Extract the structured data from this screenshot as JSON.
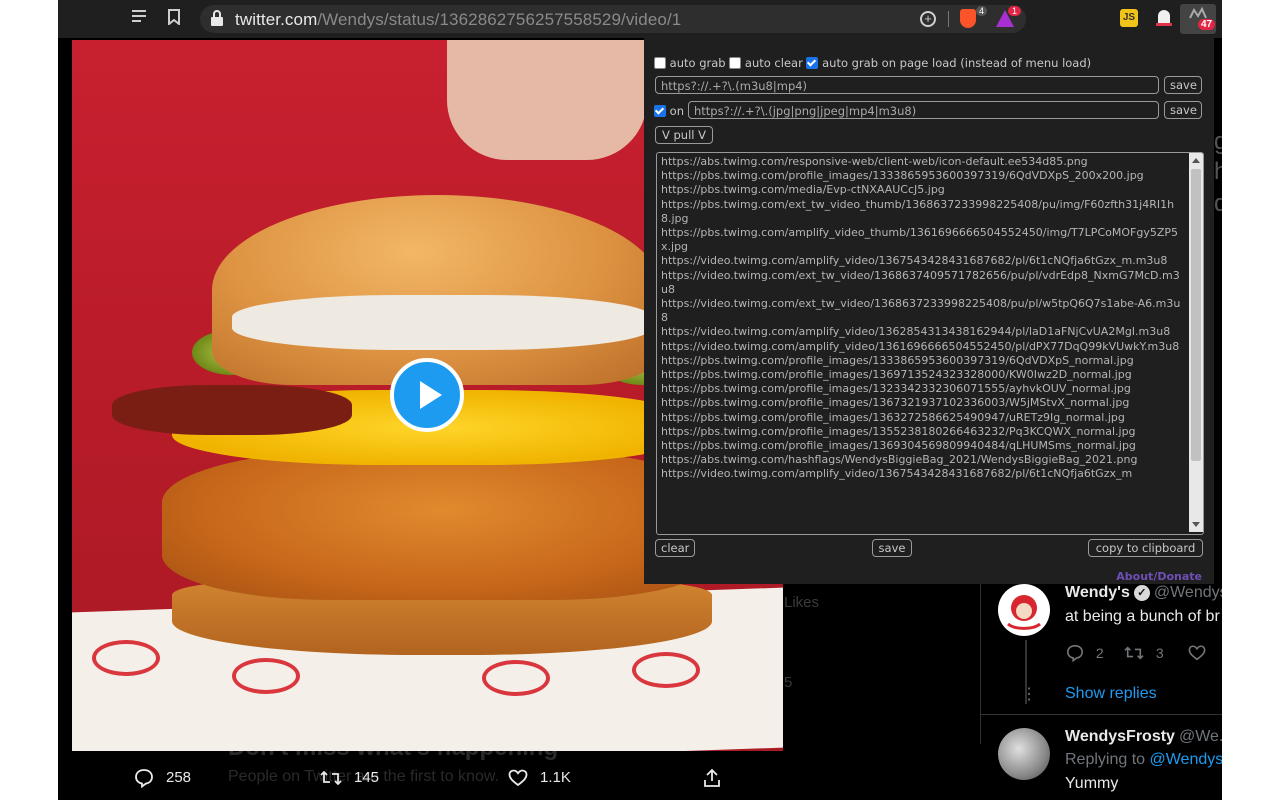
{
  "browser": {
    "url_host": "twitter.com",
    "url_path": "/Wendys/status/1362862756257558529/video/1",
    "brave_shield_count": "4",
    "rewards_badge": "1",
    "grabber_badge": "47"
  },
  "tweet_actions": {
    "replies": "258",
    "retweets": "145",
    "likes": "1.1K"
  },
  "background_text": {
    "dont_miss": "Don't miss what's happening",
    "people_on": "People on Twitter are the first to know.",
    "likes_label": "Likes",
    "number_fragment": "5"
  },
  "replies": [
    {
      "name": "Wendy's",
      "handle": "@Wendys",
      "text": "at being a bunch of br",
      "reply_count": "2",
      "retweet_count": "3",
      "show_replies": "Show replies"
    },
    {
      "name": "WendysFrosty",
      "handle": "@We...",
      "replying_label": "Replying to",
      "replying_handle": "@Wendys",
      "text": "Yummy"
    }
  ],
  "grabber_panel": {
    "auto_grab_label": "auto grab",
    "auto_clear_label": "auto clear",
    "auto_grab_page_load_label": "auto grab on page load (instead of menu load)",
    "auto_grab_checked": false,
    "auto_clear_checked": false,
    "auto_grab_page_load_checked": true,
    "pattern1": "https?://.+?\\.(m3u8|mp4)",
    "save_label": "save",
    "on_label": "on",
    "on_checked": true,
    "pattern2": "https?://.+?\\.(jpg|png|jpeg|mp4|m3u8)",
    "pull_label": "V pull V",
    "urls": [
      "https://abs.twimg.com/responsive-web/client-web/icon-default.ee534d85.png",
      "https://pbs.twimg.com/profile_images/1333865953600397319/6QdVDXpS_200x200.jpg",
      "https://pbs.twimg.com/media/Evp-ctNXAAUCcJ5.jpg",
      "https://pbs.twimg.com/ext_tw_video_thumb/1368637233998225408/pu/img/F60zfth31j4RI1h8.jpg",
      "https://pbs.twimg.com/amplify_video_thumb/1361696666504552450/img/T7LPCoMOFgy5ZP5x.jpg",
      "https://video.twimg.com/amplify_video/1367543428431687682/pl/6t1cNQfja6tGzx_m.m3u8",
      "https://video.twimg.com/ext_tw_video/1368637409571782656/pu/pl/vdrEdp8_NxmG7McD.m3u8",
      "https://video.twimg.com/ext_tw_video/1368637233998225408/pu/pl/w5tpQ6Q7s1abe-A6.m3u8",
      "https://video.twimg.com/amplify_video/1362854313438162944/pl/laD1aFNjCvUA2MgI.m3u8",
      "https://video.twimg.com/amplify_video/1361696666504552450/pl/dPX77DqQ99kVUwkY.m3u8",
      "https://pbs.twimg.com/profile_images/1333865953600397319/6QdVDXpS_normal.jpg",
      "https://pbs.twimg.com/profile_images/1369713524323328000/KW0Iwz2D_normal.jpg",
      "https://pbs.twimg.com/profile_images/1323342332306071555/ayhvkOUV_normal.jpg",
      "https://pbs.twimg.com/profile_images/1367321937102336003/W5jMStvX_normal.jpg",
      "https://pbs.twimg.com/profile_images/1363272586625490947/uRETz9Ig_normal.jpg",
      "https://pbs.twimg.com/profile_images/1355238180266463232/Pq3KCQWX_normal.jpg",
      "https://pbs.twimg.com/profile_images/1369304569809940484/qLHUMSms_normal.jpg",
      "https://abs.twimg.com/hashflags/WendysBiggieBag_2021/WendysBiggieBag_2021.png",
      "https://video.twimg.com/amplify_video/1367543428431687682/pl/6t1cNQfja6tGzx_m"
    ],
    "clear_label": "clear",
    "copy_label": "copy to clipboard",
    "about_label": "About/Donate"
  }
}
